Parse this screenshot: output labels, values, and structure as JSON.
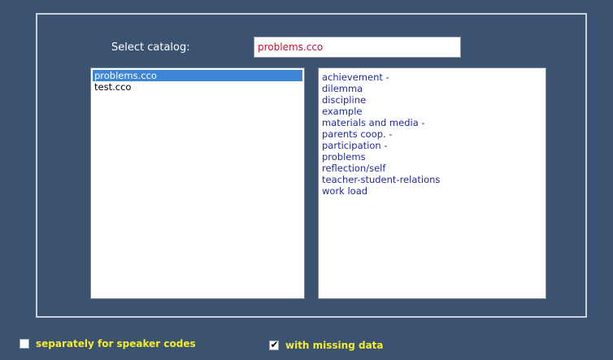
{
  "select_label": "Select catalog:",
  "catalog_input": {
    "value": "problems.cco"
  },
  "files": [
    {
      "label": "problems.cco",
      "selected": true
    },
    {
      "label": "test.cco",
      "selected": false
    }
  ],
  "codes": [
    "achievement -",
    "dilemma",
    "discipline",
    "example",
    "materials and media -",
    "parents coop. -",
    "participation -",
    "problems",
    "reflection/self",
    "teacher-student-relations",
    "work load"
  ],
  "options": {
    "speaker_codes": {
      "label": "separately for speaker codes",
      "checked": false
    },
    "missing_data": {
      "label": "with missing data",
      "checked": true,
      "check_glyph": "✔"
    }
  },
  "colors": {
    "background": "#3b5370",
    "frame": "#c9d2dc",
    "option_text": "#f4ee2b",
    "code_text": "#1f2a9e",
    "input_text": "#c8102e",
    "selection": "#3d86d6"
  }
}
